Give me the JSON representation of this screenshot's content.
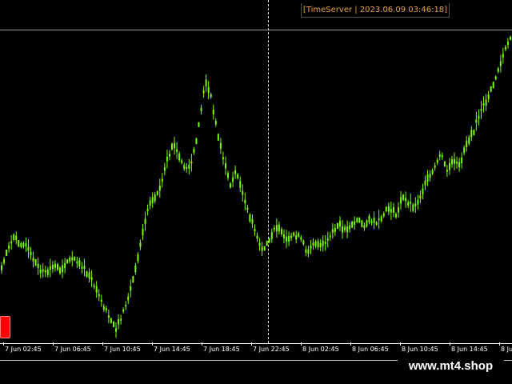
{
  "window": {
    "timeserver_label": "[TimeServer | 2023.06.09 03:46:18]",
    "watermark": "www.mt4.shop"
  },
  "colors": {
    "background": "#000000",
    "candle": "#7CFC00",
    "timeserver_text": "#e8a040",
    "marker": "#ff0000"
  },
  "chart_data": {
    "type": "line",
    "x_tick_labels": [
      "7 Jun 02:45",
      "7 Jun 06:45",
      "7 Jun 10:45",
      "7 Jun 14:45",
      "7 Jun 18:45",
      "7 Jun 22:45",
      "8 Jun 02:45",
      "8 Jun 06:45",
      "8 Jun 10:45",
      "8 Jun 14:45",
      "8 Jun 18:45"
    ],
    "grid": false,
    "series": [
      {
        "values": [
          0.58,
          0.63,
          0.65,
          0.64,
          0.63,
          0.6,
          0.58,
          0.57,
          0.59,
          0.58,
          0.59,
          0.61,
          0.6,
          0.58,
          0.56,
          0.53,
          0.5,
          0.47,
          0.45,
          0.48,
          0.52,
          0.58,
          0.65,
          0.72,
          0.74,
          0.76,
          0.82,
          0.86,
          0.83,
          0.8,
          0.82,
          0.9,
          1.0,
          0.96,
          0.88,
          0.82,
          0.77,
          0.8,
          0.74,
          0.7,
          0.66,
          0.62,
          0.64,
          0.68,
          0.66,
          0.64,
          0.66,
          0.65,
          0.62,
          0.64,
          0.63,
          0.64,
          0.66,
          0.68,
          0.67,
          0.68,
          0.69,
          0.68,
          0.69,
          0.68,
          0.7,
          0.72,
          0.7,
          0.74,
          0.73,
          0.72,
          0.75,
          0.78,
          0.8,
          0.84,
          0.8,
          0.82,
          0.81,
          0.86,
          0.88,
          0.92,
          0.95,
          0.98,
          1.02,
          1.06,
          1.1
        ]
      }
    ]
  }
}
